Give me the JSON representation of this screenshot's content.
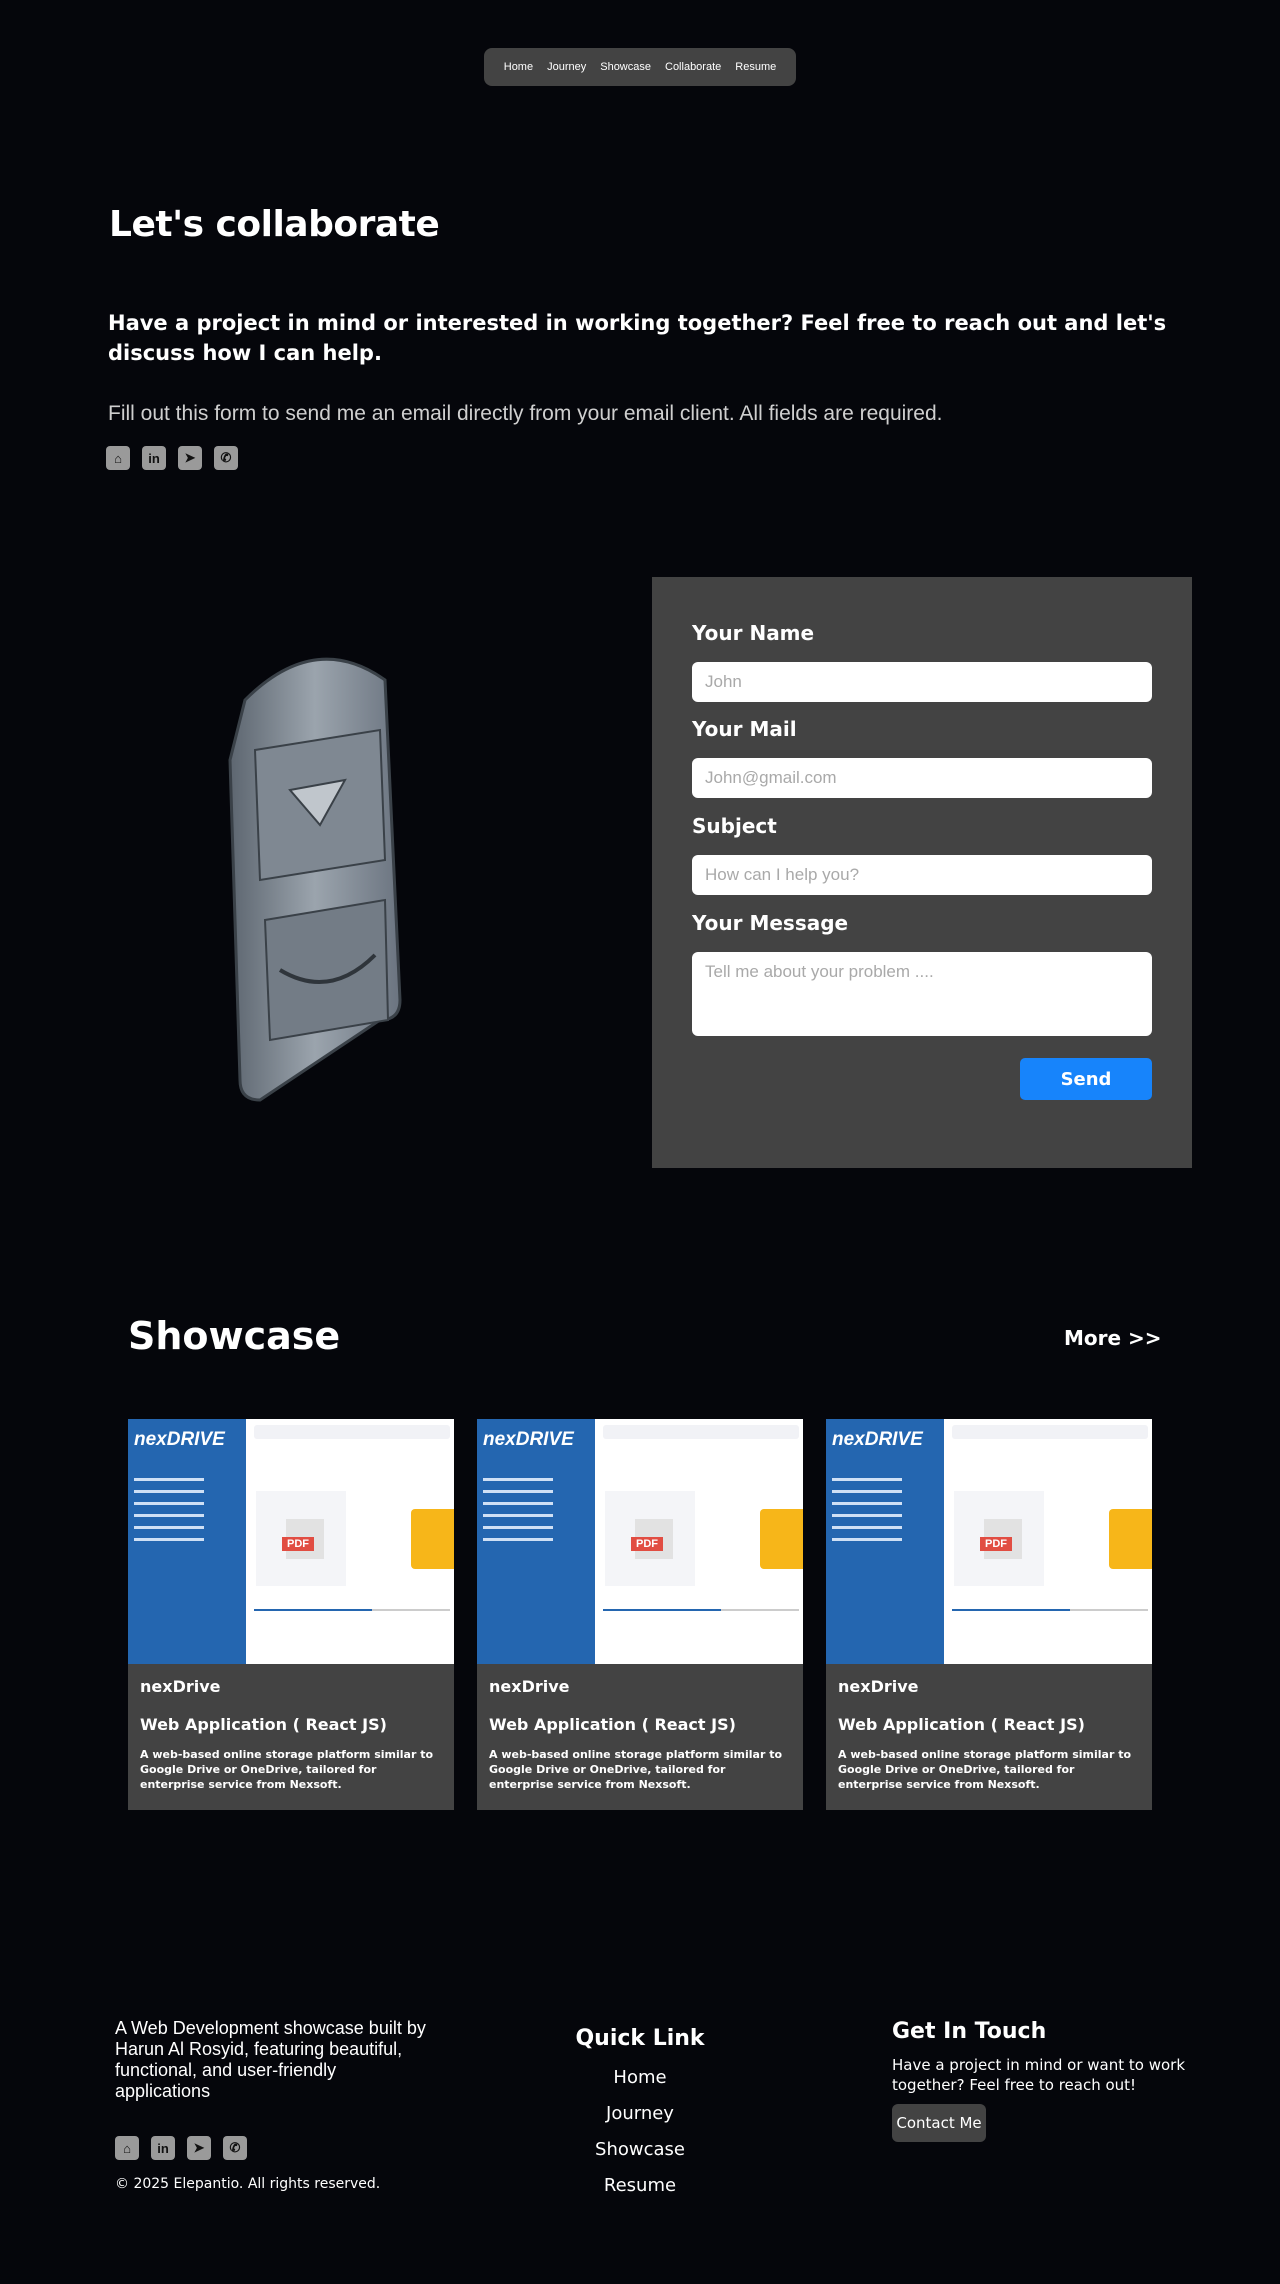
{
  "nav": {
    "items": [
      "Home",
      "Journey",
      "Showcase",
      "Collaborate",
      "Resume"
    ]
  },
  "hero": {
    "title": "Let's collaborate",
    "lead": "Have a project in mind or interested in working together? Feel free to reach out and let's discuss how I can help.",
    "sub": "Fill out this form to send me an email directly from your email client. All fields are required.",
    "socials": [
      "github-icon",
      "linkedin-icon",
      "telegram-icon",
      "whatsapp-icon"
    ]
  },
  "form": {
    "name_label": "Your Name",
    "name_placeholder": "John",
    "mail_label": "Your Mail",
    "mail_placeholder": "John@gmail.com",
    "subject_label": "Subject",
    "subject_placeholder": "How can I help you?",
    "message_label": "Your Message",
    "message_placeholder": "Tell me about your problem ....",
    "send_label": "Send"
  },
  "showcase": {
    "title": "Showcase",
    "more": "More >>",
    "cards": [
      {
        "logo": "nexDRIVE",
        "name": "nexDrive",
        "type": "Web Application ( React JS)",
        "desc": "A web-based online storage platform similar to Google Drive or OneDrive, tailored for enterprise service from Nexsoft."
      },
      {
        "logo": "nexDRIVE",
        "name": "nexDrive",
        "type": "Web Application ( React JS)",
        "desc": "A web-based online storage platform similar to Google Drive or OneDrive, tailored for enterprise service from Nexsoft."
      },
      {
        "logo": "nexDRIVE",
        "name": "nexDrive",
        "type": "Web Application ( React JS)",
        "desc": "A web-based online storage platform similar to Google Drive or OneDrive, tailored for enterprise service from Nexsoft."
      }
    ]
  },
  "footer": {
    "about": "A Web Development showcase built by Harun Al Rosyid, featuring beautiful, functional, and user-friendly applications",
    "copyright": "© 2025 Elepantio. All rights reserved.",
    "quick_title": "Quick Link",
    "quick_links": [
      "Home",
      "Journey",
      "Showcase",
      "Resume"
    ],
    "touch_title": "Get In Touch",
    "touch_text": "Have a project in mind or want to work together? Feel free to reach out!",
    "contact_label": "Contact Me"
  },
  "colors": {
    "background": "#05060b",
    "panel": "#434343",
    "accent": "#1784fb"
  }
}
